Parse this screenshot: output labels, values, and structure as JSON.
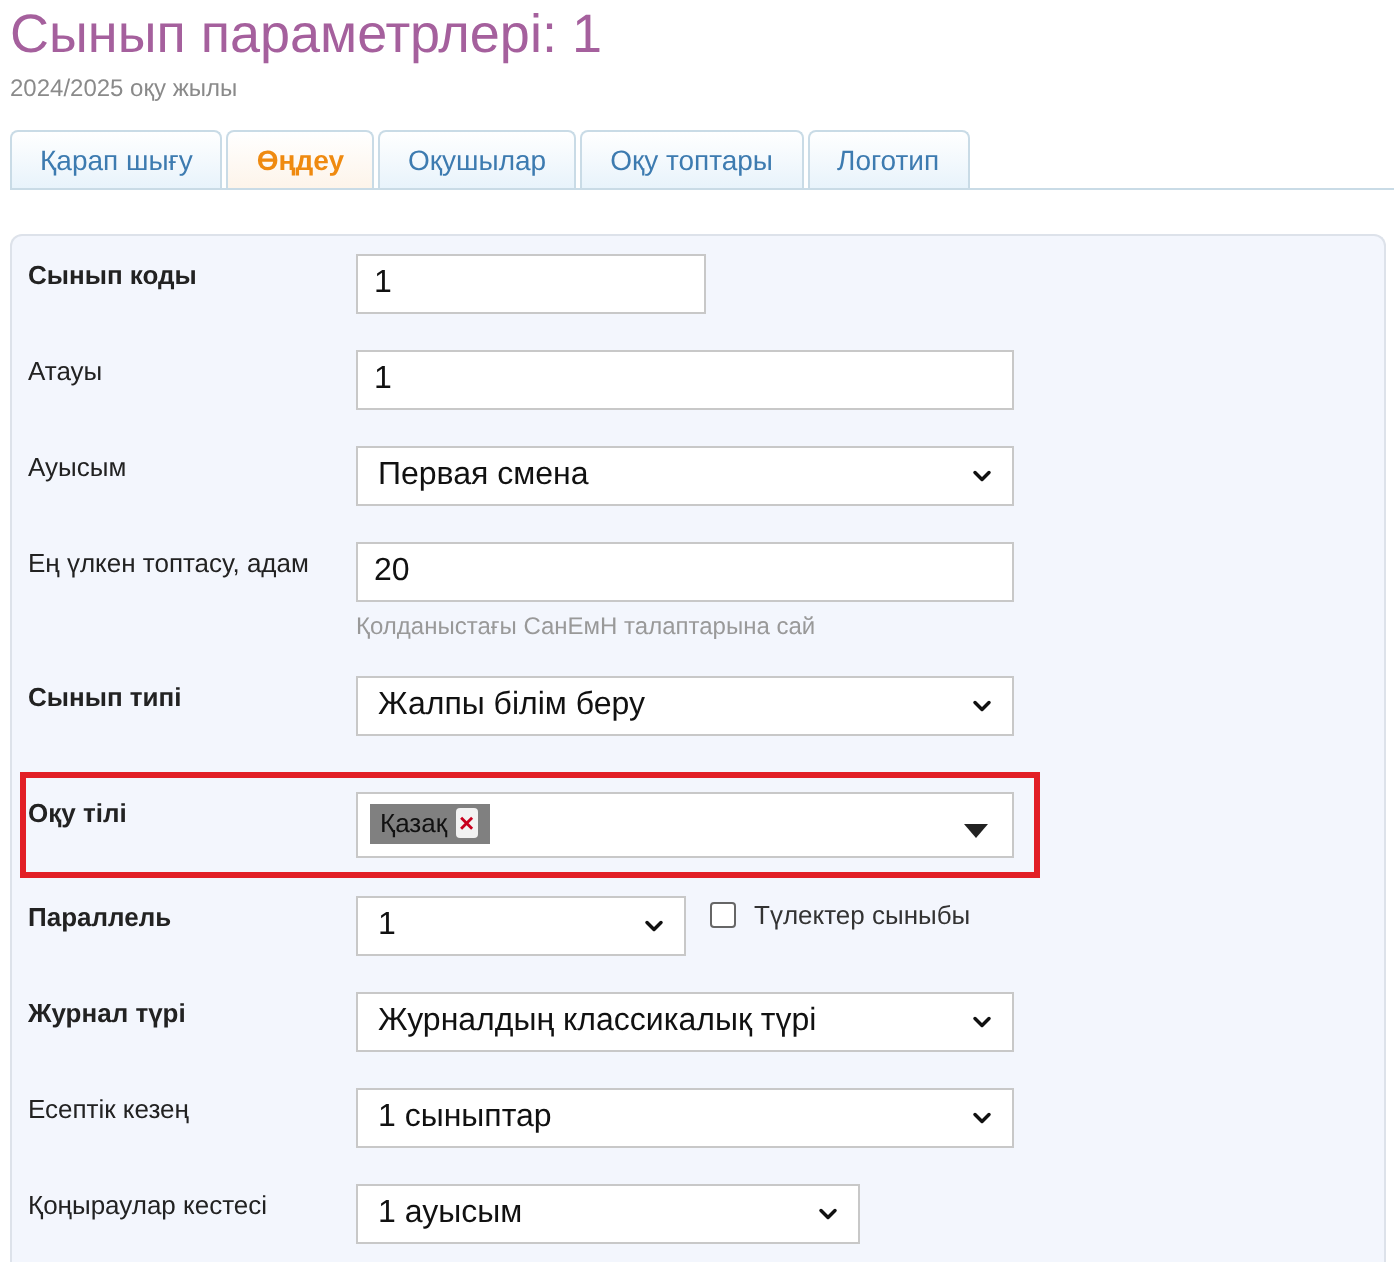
{
  "header": {
    "title": "Сынып параметрлері: 1",
    "subtitle": "2024/2025 оқу жылы"
  },
  "tabs": [
    {
      "label": "Қарап шығу",
      "selected": false
    },
    {
      "label": "Өңдеу",
      "selected": true
    },
    {
      "label": "Оқушылар",
      "selected": false
    },
    {
      "label": "Оқу топтары",
      "selected": false
    },
    {
      "label": "Логотип",
      "selected": false
    }
  ],
  "form": {
    "rows": [
      {
        "kind": "text",
        "label": "Сынып коды",
        "bold": true,
        "value": "1"
      },
      {
        "kind": "text",
        "label": "Атауы",
        "bold": false,
        "value": "1"
      },
      {
        "kind": "select",
        "label": "Ауысым",
        "bold": false,
        "value": "Первая смена"
      },
      {
        "kind": "text",
        "label": "Ең үлкен топтасу, адам",
        "bold": false,
        "value": "20",
        "hint": "Қолданыстағы СанЕмН талаптарына сай"
      },
      {
        "kind": "select",
        "label": "Сынып типі",
        "bold": true,
        "value": "Жалпы білім беру"
      },
      {
        "kind": "multiselect",
        "label": "Оқу тілі",
        "bold": true,
        "highlighted": true,
        "tags": [
          {
            "label": "Қазақ",
            "remove": "×"
          }
        ]
      },
      {
        "kind": "select_check",
        "label": "Параллель",
        "bold": true,
        "value": "1",
        "checkbox": {
          "label": "Түлектер сыныбы",
          "checked": false
        }
      },
      {
        "kind": "select",
        "label": "Журнал түрі",
        "bold": true,
        "value": "Журналдың классикалық түрі"
      },
      {
        "kind": "select",
        "label": "Есептік кезең",
        "bold": false,
        "value": "1 сыныптар"
      },
      {
        "kind": "select",
        "label": "Қоңыраулар кестесі",
        "bold": false,
        "value": "1 ауысым"
      }
    ]
  }
}
